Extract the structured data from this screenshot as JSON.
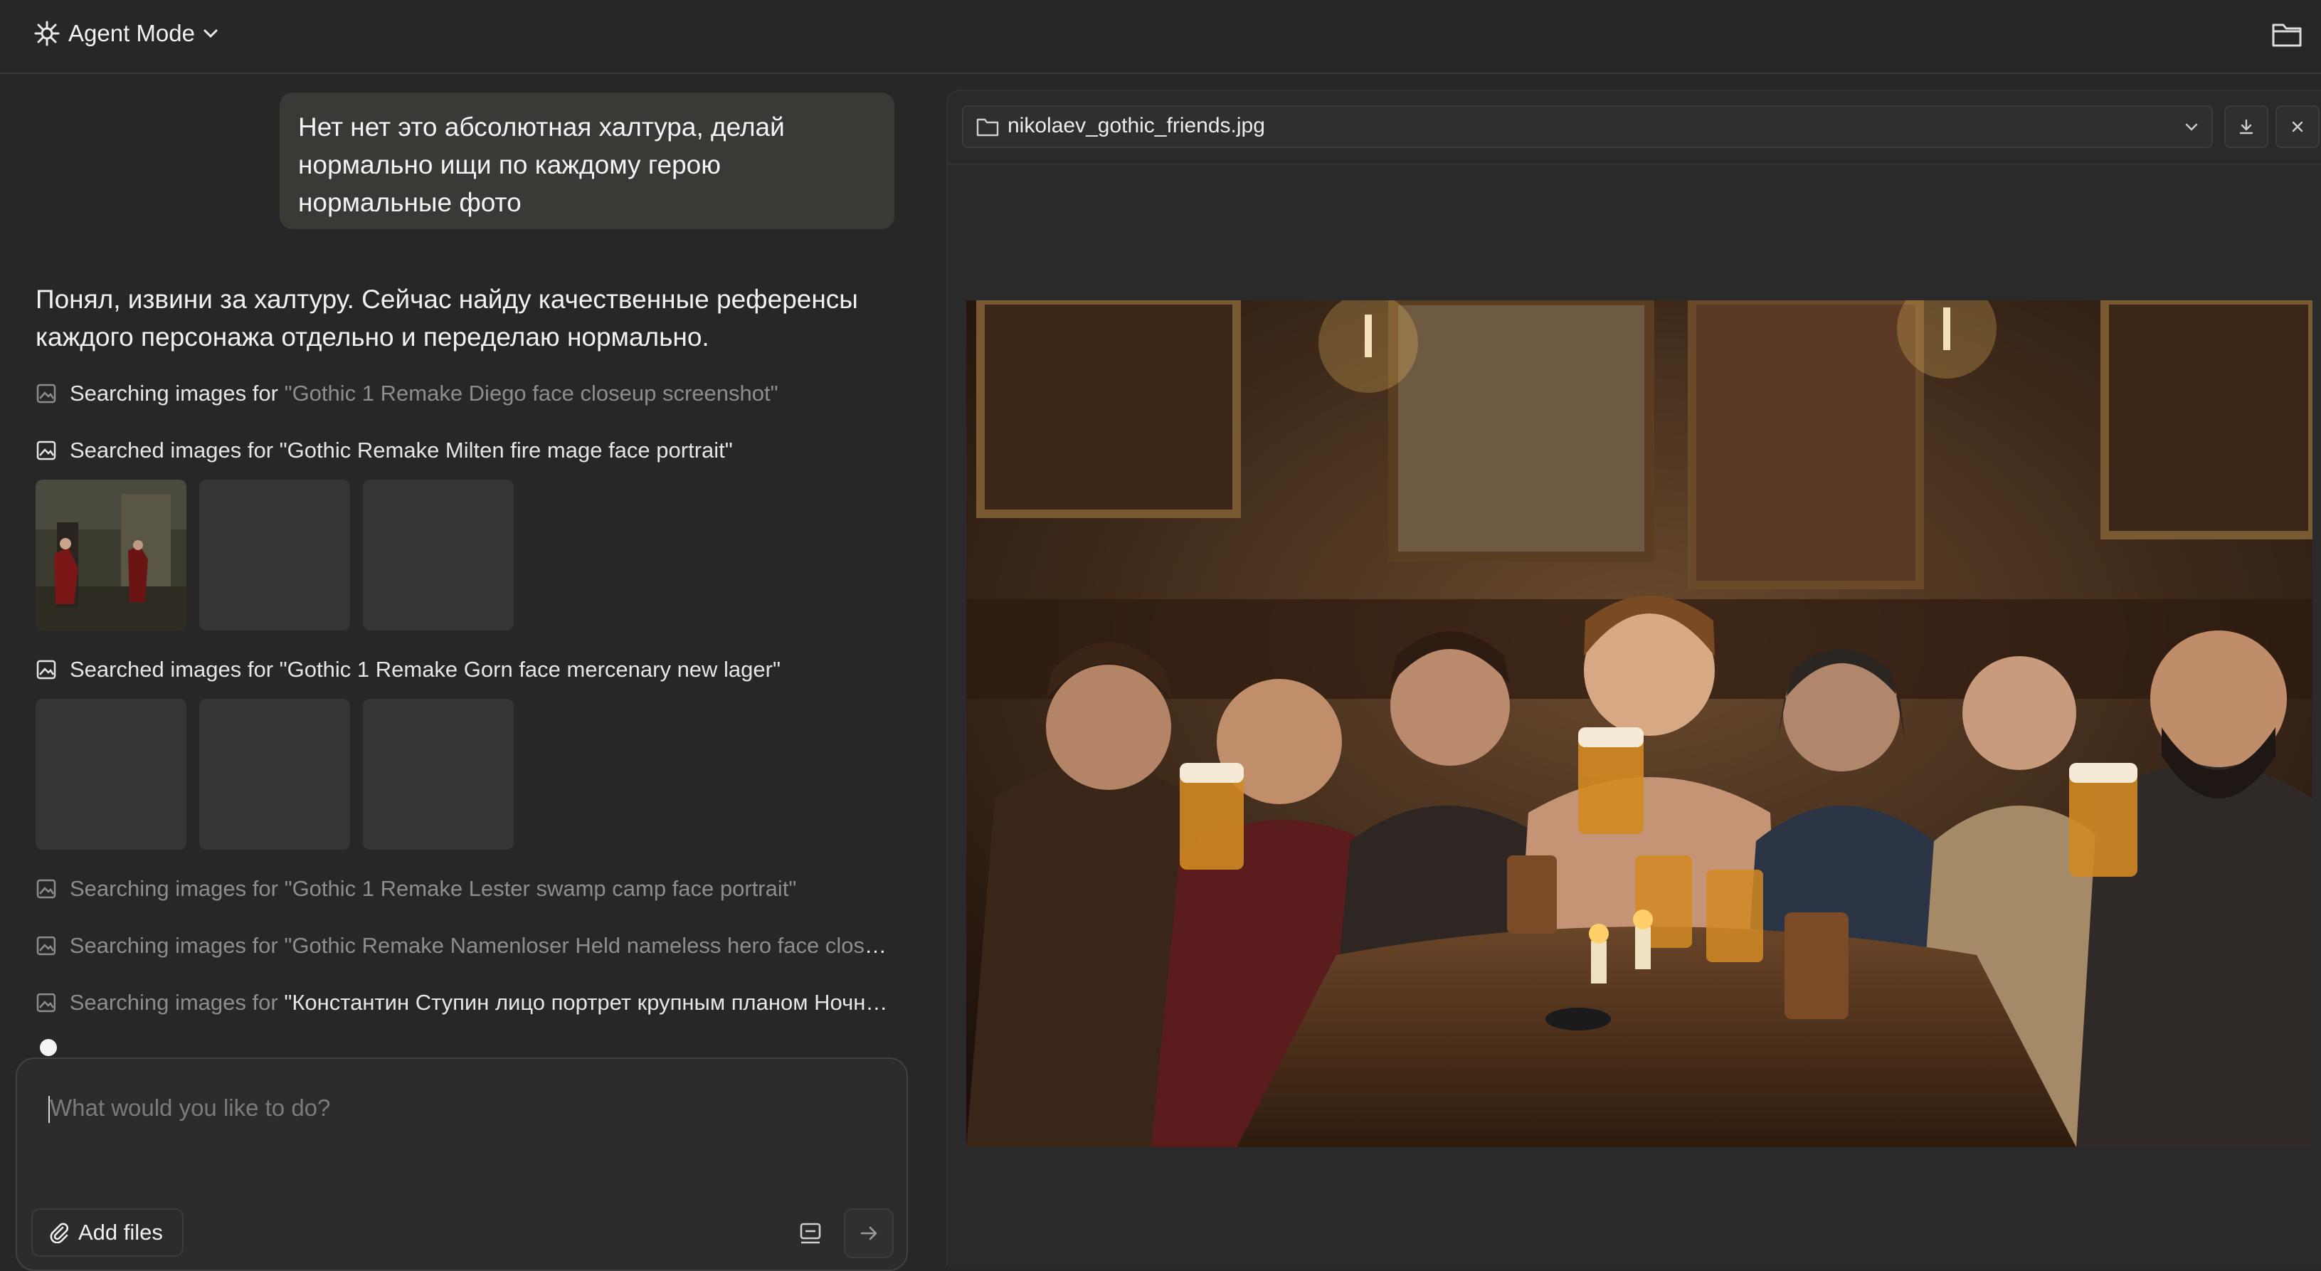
{
  "header": {
    "mode_label": "Agent Mode",
    "mode_icon": "sparkle-icon",
    "folder_icon": "folder-icon"
  },
  "chat": {
    "user_message": "Нет нет это абсолютная халтура, делай нормально ищи по каждому герою нормальные фото",
    "assistant_message": "Понял, извини за халтуру. Сейчас найду качественные референсы каждого персонажа отдельно и переделаю нормально.",
    "searches": [
      {
        "status": "Searching images for",
        "query": "\"Gothic 1 Remake Diego face closeup screenshot\""
      },
      {
        "status": "Searched images for",
        "query": "\"Gothic Remake Milten fire mage face portrait\""
      },
      {
        "status": "Searched images for",
        "query": "\"Gothic 1 Remake Gorn face mercenary new lager\""
      },
      {
        "status": "Searching images for",
        "query": "\"Gothic 1 Remake Lester swamp camp face portrait\""
      },
      {
        "status": "Searching images for",
        "query": "\"Gothic Remake Namenloser Held nameless hero face close..."
      },
      {
        "status": "Searching images for",
        "query": "\"Константин Ступин лицо портрет крупным планом Ночна..."
      }
    ]
  },
  "composer": {
    "placeholder": "What would you like to do?",
    "add_files_label": "Add files"
  },
  "viewer": {
    "file_name": "nikolaev_gothic_friends.jpg"
  },
  "colors": {
    "background": "#272727",
    "bubble": "#3b3936",
    "panel": "#2a2a2a"
  }
}
